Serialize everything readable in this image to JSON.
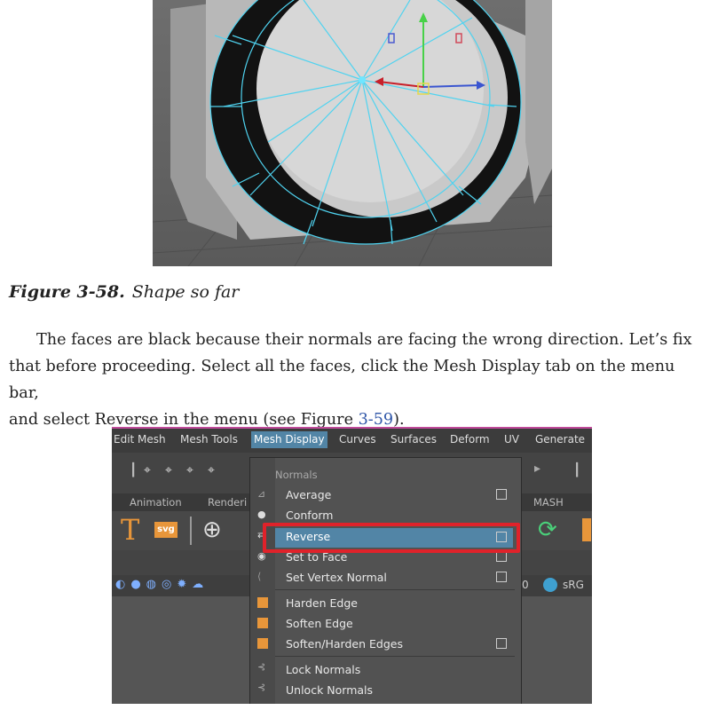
{
  "figure_top": {
    "caption_label": "Figure 3-58.",
    "caption_text": "Shape so far"
  },
  "paragraph": {
    "line1": "The faces are black because their normals are facing the wrong direction. Let’s fix",
    "line2": "that before proceeding. Select all the faces, click the Mesh Display tab on the menu bar,",
    "line3_before": "and select Reverse in the menu (see Figure ",
    "line3_ref": "3-59",
    "line3_after": ")."
  },
  "maya": {
    "menubar": [
      "Edit Mesh",
      "Mesh Tools",
      "Mesh Display",
      "Curves",
      "Surfaces",
      "Deform",
      "UV",
      "Generate"
    ],
    "shelf_tabs": [
      "Animation",
      "Renderi",
      "MASH"
    ],
    "tool2_label": "sRG",
    "tool2_value": "0",
    "menu": {
      "header": "Normals",
      "items": [
        {
          "label": "Average",
          "option_box": true
        },
        {
          "label": "Conform",
          "option_box": false
        },
        {
          "label": "Reverse",
          "option_box": true,
          "highlighted": true
        },
        {
          "label": "Set to Face",
          "option_box": true
        },
        {
          "label": "Set Vertex Normal",
          "option_box": true
        },
        {
          "label": "Harden Edge",
          "option_box": false
        },
        {
          "label": "Soften Edge",
          "option_box": false
        },
        {
          "label": "Soften/Harden Edges",
          "option_box": true
        },
        {
          "label": "Lock Normals",
          "option_box": false
        },
        {
          "label": "Unlock Normals",
          "option_box": false
        }
      ]
    },
    "highlight_color": "#5285a6",
    "callout_color": "#e0222a"
  }
}
